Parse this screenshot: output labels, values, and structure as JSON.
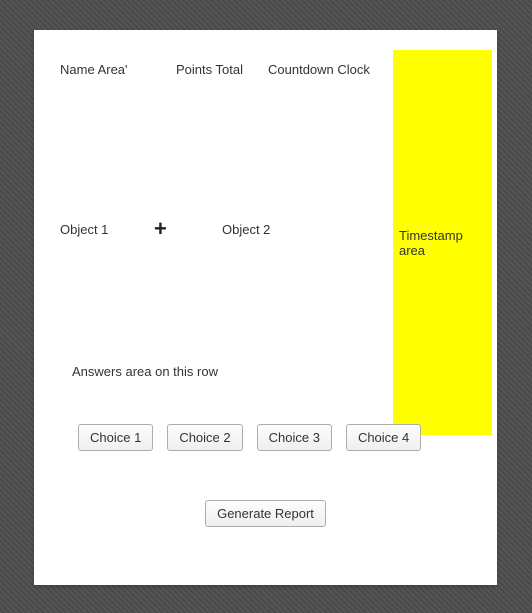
{
  "header": {
    "name_label": "Name Area'",
    "points_label": "Points Total",
    "clock_label": "Countdown Clock"
  },
  "objects": {
    "left": "Object 1",
    "right": "Object 2",
    "plus_glyph": "+"
  },
  "timestamp": {
    "label": "Timestamp area"
  },
  "answers": {
    "label": "Answers area on this row"
  },
  "choices": [
    {
      "label": "Choice 1"
    },
    {
      "label": "Choice 2"
    },
    {
      "label": "Choice 3"
    },
    {
      "label": "Choice 4"
    }
  ],
  "footer": {
    "generate_label": "Generate Report"
  },
  "colors": {
    "timestamp_bg": "#ffff00"
  }
}
